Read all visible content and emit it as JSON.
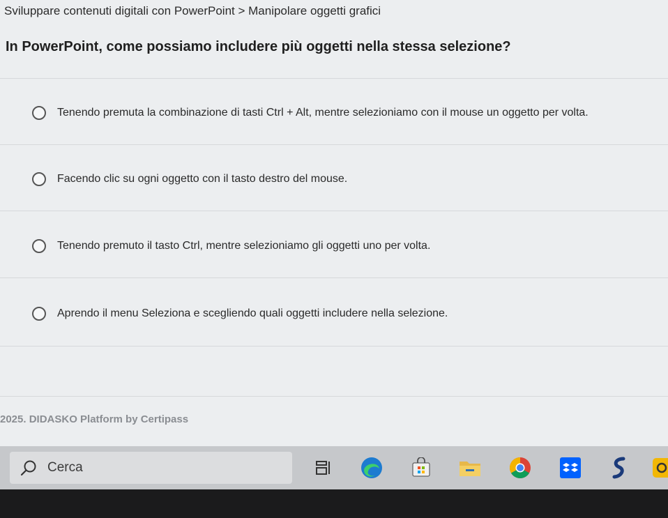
{
  "breadcrumb": "Sviluppare contenuti digitali con PowerPoint > Manipolare oggetti grafici",
  "question": "In PowerPoint, come possiamo includere più oggetti nella stessa selezione?",
  "options": [
    {
      "label": "Tenendo premuta la combinazione di tasti Ctrl + Alt, mentre selezioniamo con il mouse un oggetto per volta."
    },
    {
      "label": "Facendo clic su ogni oggetto con il tasto destro del mouse."
    },
    {
      "label": "Tenendo premuto il tasto Ctrl, mentre selezioniamo gli oggetti uno per volta."
    },
    {
      "label": "Aprendo il menu Seleziona e scegliendo quali oggetti includere nella selezione."
    }
  ],
  "footer": "2025. DIDASKO Platform by Certipass",
  "taskbar": {
    "search_placeholder": "Cerca",
    "icons": [
      "task-view-icon",
      "edge-icon",
      "store-icon",
      "file-explorer-icon",
      "chrome-icon",
      "dropbox-icon",
      "app-s-icon",
      "partial-app-icon"
    ]
  },
  "colors": {
    "page_bg": "#eceef0",
    "taskbar_bg": "#c6c8cb",
    "text": "#2a2a2a",
    "footer_text": "#8a8d92"
  }
}
